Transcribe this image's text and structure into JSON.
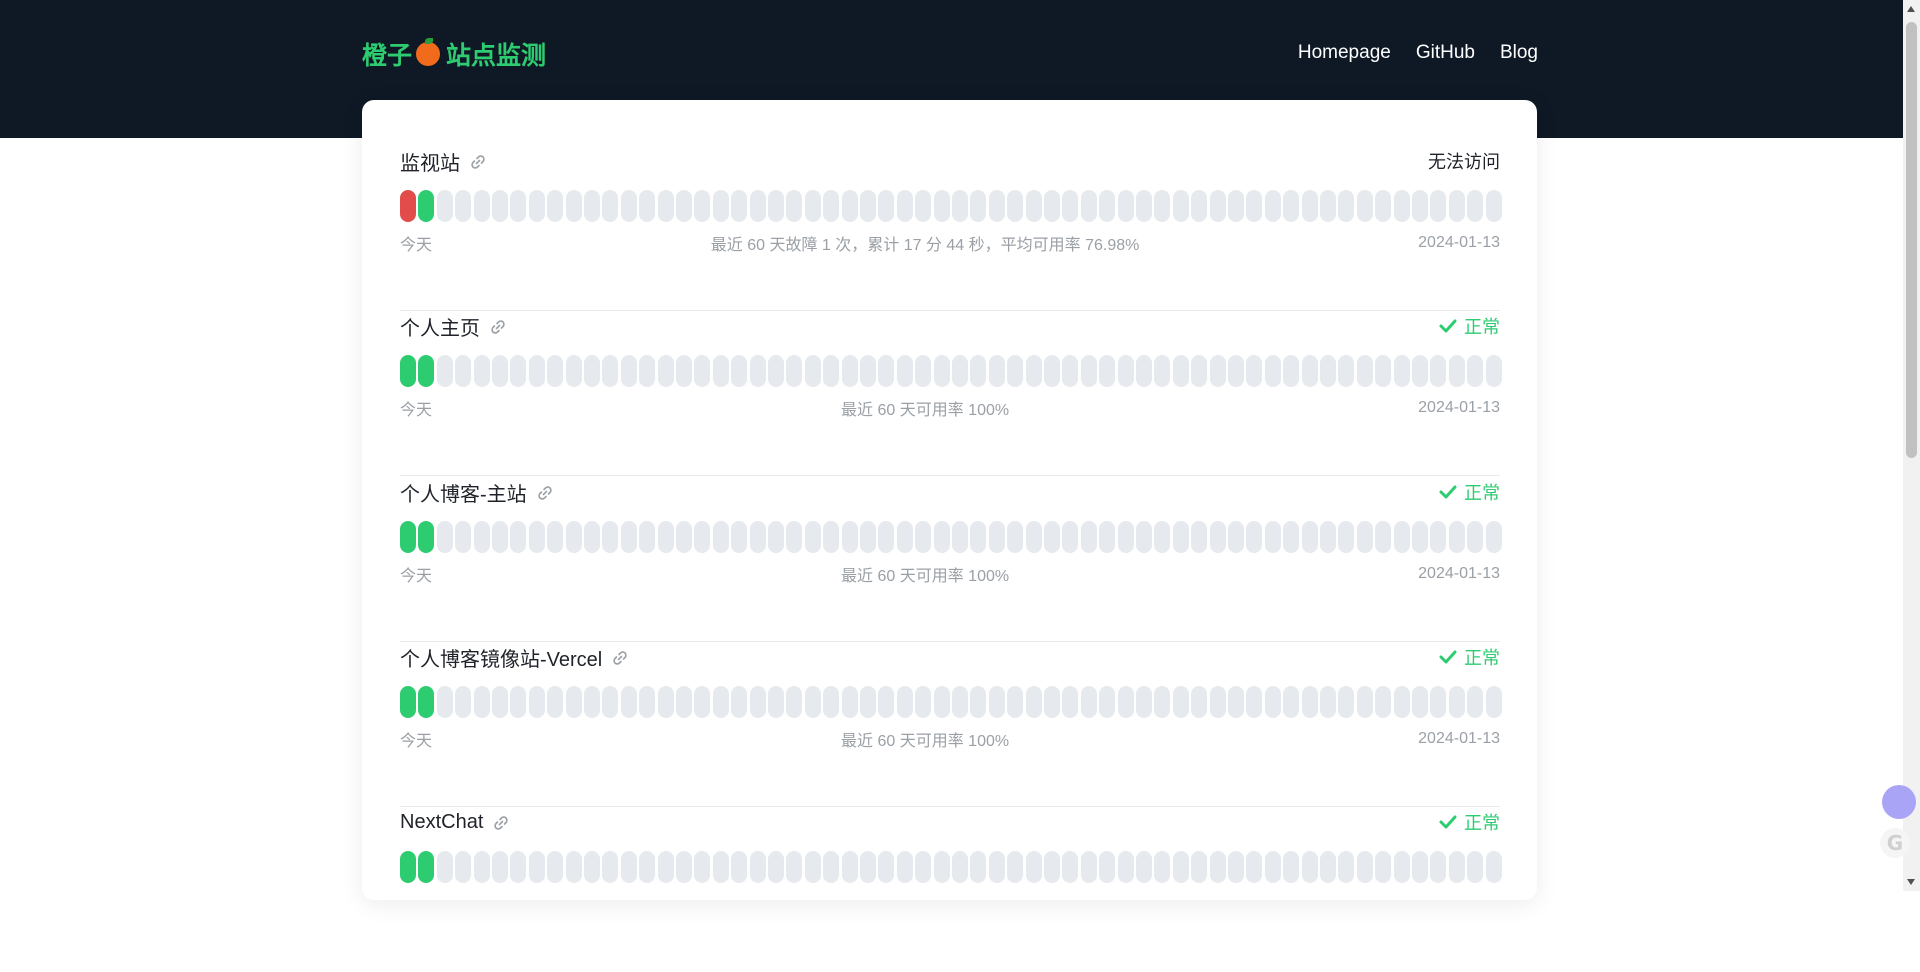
{
  "header": {
    "brand_left": "橙子",
    "brand_right": "站点监测",
    "nav": [
      {
        "label": "Homepage"
      },
      {
        "label": "GitHub"
      },
      {
        "label": "Blog"
      }
    ]
  },
  "colors": {
    "header_bg": "#0f1926",
    "brand_green": "#2ecc71",
    "bar_up": "#2ecc71",
    "bar_down": "#e24c4b",
    "bar_empty": "#e6e9ed"
  },
  "monitors": [
    {
      "name": "监视站",
      "status": "无法访问",
      "status_type": "down",
      "bars": [
        "down",
        "up"
      ],
      "footer_left": "今天",
      "footer_middle": "最近 60 天故障 1 次，累计 17 分 44 秒，平均可用率 76.98%",
      "footer_right": "2024-01-13"
    },
    {
      "name": "个人主页",
      "status": "正常",
      "status_type": "ok",
      "bars": [
        "up",
        "up"
      ],
      "footer_left": "今天",
      "footer_middle": "最近 60 天可用率 100%",
      "footer_right": "2024-01-13"
    },
    {
      "name": "个人博客-主站",
      "status": "正常",
      "status_type": "ok",
      "bars": [
        "up",
        "up"
      ],
      "footer_left": "今天",
      "footer_middle": "最近 60 天可用率 100%",
      "footer_right": "2024-01-13"
    },
    {
      "name": "个人博客镜像站-Vercel",
      "status": "正常",
      "status_type": "ok",
      "bars": [
        "up",
        "up"
      ],
      "footer_left": "今天",
      "footer_middle": "最近 60 天可用率 100%",
      "footer_right": "2024-01-13"
    },
    {
      "name": "NextChat",
      "status": "正常",
      "status_type": "ok",
      "bars": [
        "up",
        "up"
      ],
      "footer_left": "",
      "footer_middle": "",
      "footer_right": ""
    }
  ],
  "icons": {
    "brand": "orange-icon",
    "link": "link-icon",
    "ok": "check-icon"
  }
}
